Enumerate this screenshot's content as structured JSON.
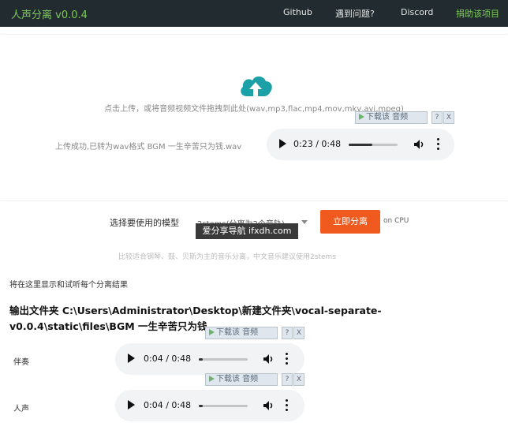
{
  "nav": {
    "brand": "人声分离 v0.0.4",
    "links": [
      "Github",
      "遇到问题?",
      "Discord",
      "捐助该项目"
    ]
  },
  "upload": {
    "hint": "点击上传，或将音频视频文件拖拽到此处(wav,mp3,flac,mp4,mov,mkv,avi,mpeg)",
    "status": "上传成功,已转为wav格式 BGM 一生辛苦只为钱.wav",
    "player": {
      "time": "0:23 / 0:48",
      "progress": 0.479
    }
  },
  "download_widget": {
    "label": "下载该 音频",
    "help": "?",
    "close": "X"
  },
  "model": {
    "label": "选择要使用的模型",
    "selected": "2stems(分离为2个音轨)",
    "button": "立即分离",
    "device": "on CPU",
    "tip": "比较适合钢琴、鼓、贝斯为主的音乐分离，中文音乐建议使用2stems"
  },
  "watermark": "爱分享导航 ifxdh.com",
  "results": {
    "tip": "将在这里显示和试听每个分离结果",
    "output_folder": "输出文件夹 C:\\Users\\Administrator\\Desktop\\新建文件夹\\vocal-separate-v0.0.4\\static\\files\\BGM 一生辛苦只为钱",
    "tracks": [
      {
        "label": "伴奏",
        "time": "0:04 / 0:48",
        "progress": 0.083
      },
      {
        "label": "人声",
        "time": "0:04 / 0:48",
        "progress": 0.083
      }
    ]
  },
  "colors": {
    "nav_bg": "#222b2f",
    "brand": "#7ecb5a",
    "accent_button": "#f05a1e",
    "upload_icon": "#1aa0a6"
  },
  "icons": {
    "upload": "cloud-upload-icon",
    "play": "play-icon",
    "volume": "volume-icon",
    "more": "more-vert-icon"
  }
}
